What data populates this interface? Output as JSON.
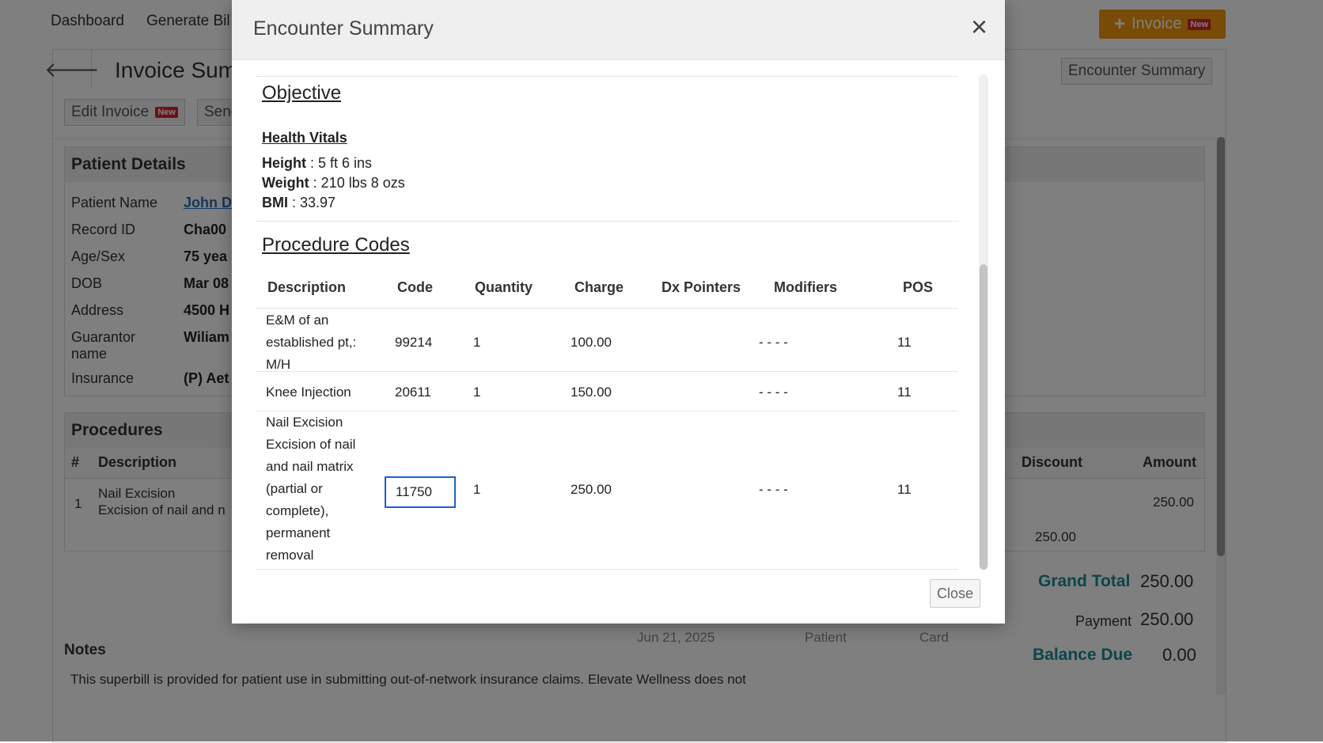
{
  "nav": {
    "dashboard": "Dashboard",
    "generate_bill": "Generate Bil"
  },
  "invoice_button": {
    "label": "Invoice",
    "badge": "New"
  },
  "page": {
    "title": "Invoice Summ",
    "encounter_summary_button": "Encounter Summary",
    "edit_invoice": "Edit Invoice",
    "edit_badge": "New",
    "send": "Send"
  },
  "patient": {
    "section_title": "Patient Details",
    "rows": [
      {
        "label": "Patient Name",
        "value": "John D"
      },
      {
        "label": "Record ID",
        "value": "Cha00"
      },
      {
        "label": "Age/Sex",
        "value": "75 yea"
      },
      {
        "label": "DOB",
        "value": "Mar 08"
      },
      {
        "label": "Address",
        "value": "4500 H"
      },
      {
        "label": "Guarantor",
        "label2": "name",
        "value": "Wiliam"
      },
      {
        "label": "Insurance",
        "value": "(P) Aet"
      }
    ]
  },
  "procedures": {
    "section_title": "Procedures",
    "headers": {
      "num": "#",
      "description": "Description",
      "discount": "Discount",
      "amount": "Amount"
    },
    "row": {
      "num": "1",
      "desc1": "Nail Excision",
      "desc2": "Excision of nail and n",
      "amount": "250.00"
    },
    "subtotal": "250.00"
  },
  "totals": {
    "grand_total_label": "Grand Total",
    "grand_total": "250.00",
    "payment_label": "Payment",
    "payment": "250.00",
    "balance_label": "Balance Due",
    "balance": "0.00"
  },
  "payment_row_partial": {
    "date": "Jun 21, 2025",
    "by": "Patient",
    "method": "Card"
  },
  "notes": {
    "title": "Notes",
    "text": "This superbill is provided for patient use in submitting out-of-network insurance claims. Elevate Wellness does not"
  },
  "modal": {
    "title": "Encounter Summary",
    "close_x": "×",
    "close_button": "Close",
    "objective_heading": "Objective",
    "vitals_heading": "Health Vitals",
    "vitals": [
      {
        "label": "Height",
        "value": " : 5 ft 6 ins"
      },
      {
        "label": "Weight",
        "value": " : 210 lbs 8 ozs"
      },
      {
        "label": "BMI",
        "value": " : 33.97"
      }
    ],
    "procedure_heading": "Procedure Codes",
    "columns": [
      "Description",
      "Code",
      "Quantity",
      "Charge",
      "Dx Pointers",
      "Modifiers",
      "POS"
    ],
    "rows": [
      {
        "desc": [
          "E&M of an",
          "established pt,:",
          "M/H"
        ],
        "code": "99214",
        "qty": "1",
        "charge": "100.00",
        "dx": "",
        "mods": "- - - -",
        "pos": "11"
      },
      {
        "desc": [
          "Knee Injection"
        ],
        "code": "20611",
        "qty": "1",
        "charge": "150.00",
        "dx": "",
        "mods": "- - - -",
        "pos": "11"
      },
      {
        "desc": [
          "Nail Excision",
          "Excision of nail",
          "and nail matrix",
          "(partial or",
          "complete),",
          "permanent",
          "removal"
        ],
        "code": "11750",
        "qty": "1",
        "charge": "250.00",
        "dx": "",
        "mods": "- - - -",
        "pos": "11"
      }
    ]
  },
  "colors": {
    "accent_orange": "#f0960e",
    "badge_red": "#d9232d",
    "teal": "#1a8a96",
    "focus_blue": "#1e5fd0"
  }
}
